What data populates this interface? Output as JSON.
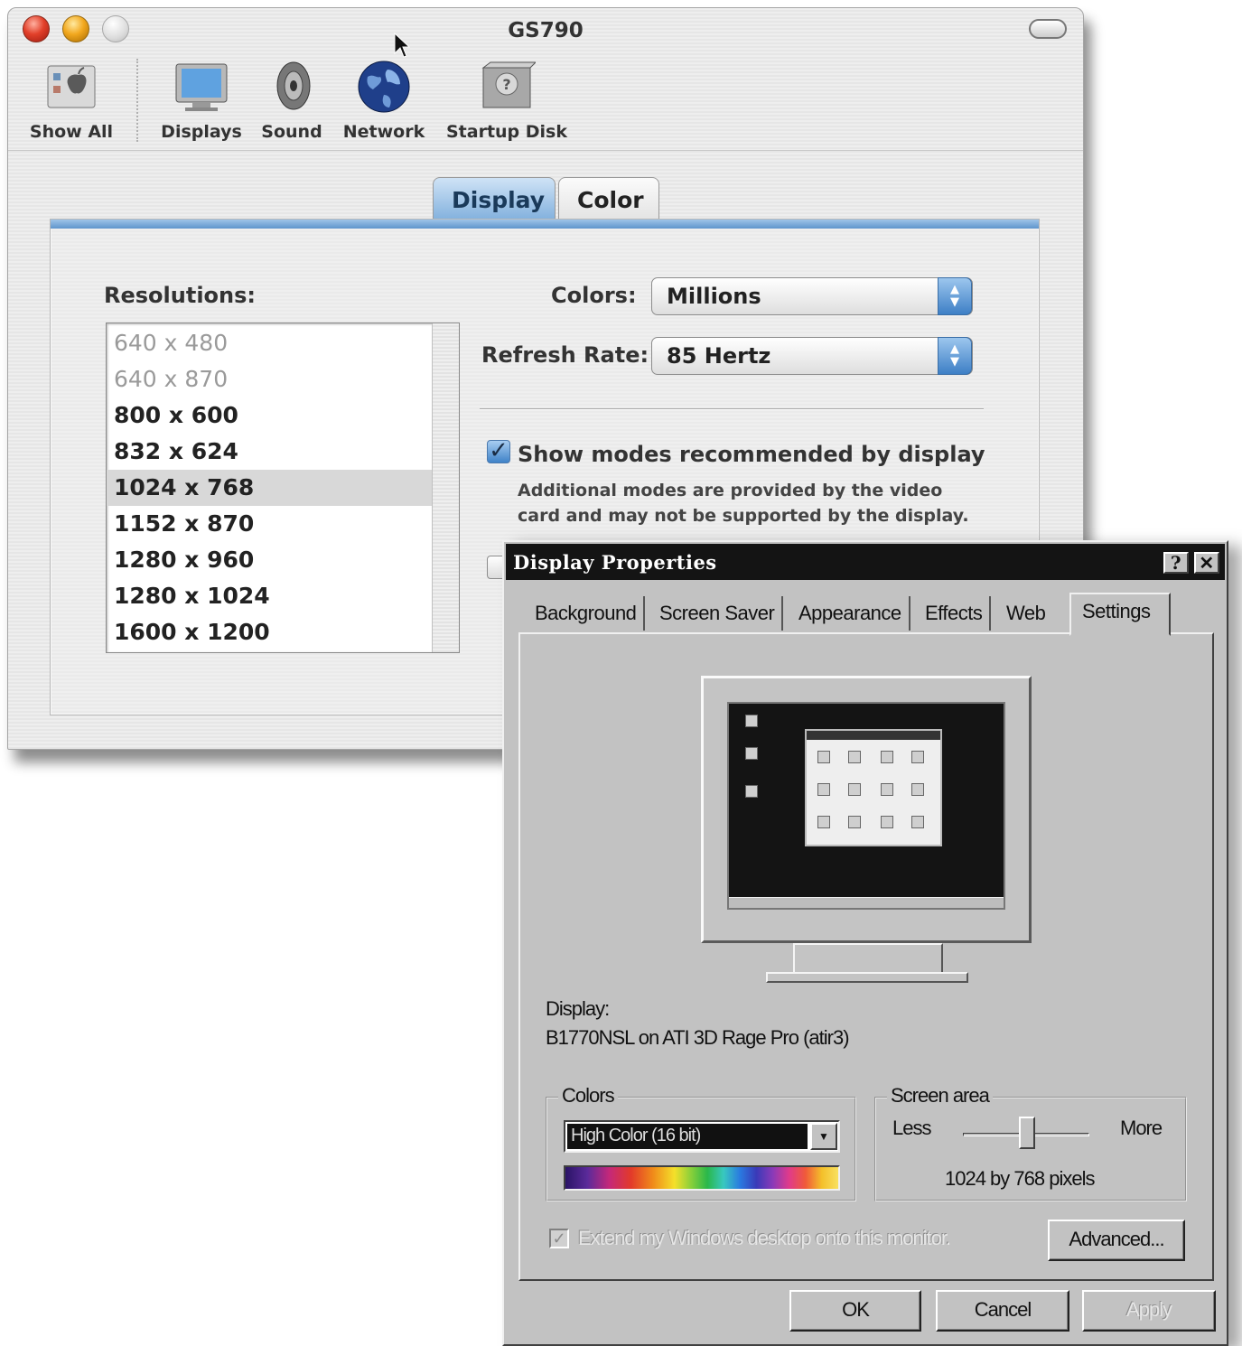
{
  "mac": {
    "title": "GS790",
    "toolbar": [
      {
        "label": "Show All",
        "icon": "apple-prefs-icon"
      },
      {
        "label": "Displays",
        "icon": "monitor-icon"
      },
      {
        "label": "Sound",
        "icon": "speaker-icon"
      },
      {
        "label": "Network",
        "icon": "globe-icon"
      },
      {
        "label": "Startup Disk",
        "icon": "hard-disk-icon"
      }
    ],
    "tabs": [
      {
        "label": "Display",
        "active": true
      },
      {
        "label": "Color",
        "active": false
      }
    ],
    "resolutions_label": "Resolutions:",
    "resolutions": [
      {
        "value": "640 x 480",
        "dimmed": true
      },
      {
        "value": "640 x 870",
        "dimmed": true
      },
      {
        "value": "800 x 600",
        "dimmed": false
      },
      {
        "value": "832 x 624",
        "dimmed": false
      },
      {
        "value": "1024 x 768",
        "dimmed": false,
        "selected": true
      },
      {
        "value": "1152 x 870",
        "dimmed": false
      },
      {
        "value": "1280 x 960",
        "dimmed": false
      },
      {
        "value": "1280 x 1024",
        "dimmed": false
      },
      {
        "value": "1600 x 1200",
        "dimmed": false
      }
    ],
    "colors_label": "Colors:",
    "colors_value": "Millions",
    "refresh_label": "Refresh Rate:",
    "refresh_value": "85 Hertz",
    "show_modes_label": "Show modes recommended by display",
    "show_modes_checked": true,
    "show_modes_note": "Additional modes are provided by the video card and may not be supported by the display.",
    "accent_color": "#5e95cc"
  },
  "win": {
    "title": "Display Properties",
    "help_btn": "?",
    "close_btn": "✕",
    "tabs": [
      "Background",
      "Screen Saver",
      "Appearance",
      "Effects",
      "Web",
      "Settings"
    ],
    "active_tab": "Settings",
    "display_label": "Display:",
    "display_value": "B1770NSL on ATI 3D Rage Pro (atir3)",
    "colors_group": "Colors",
    "colors_value": "High Color (16 bit)",
    "screen_area_group": "Screen area",
    "less_label": "Less",
    "more_label": "More",
    "screen_area_value": "1024 by 768 pixels",
    "extend_label": "Extend my Windows desktop onto this monitor.",
    "extend_checked": true,
    "advanced_label": "Advanced...",
    "ok_label": "OK",
    "cancel_label": "Cancel",
    "apply_label": "Apply"
  }
}
